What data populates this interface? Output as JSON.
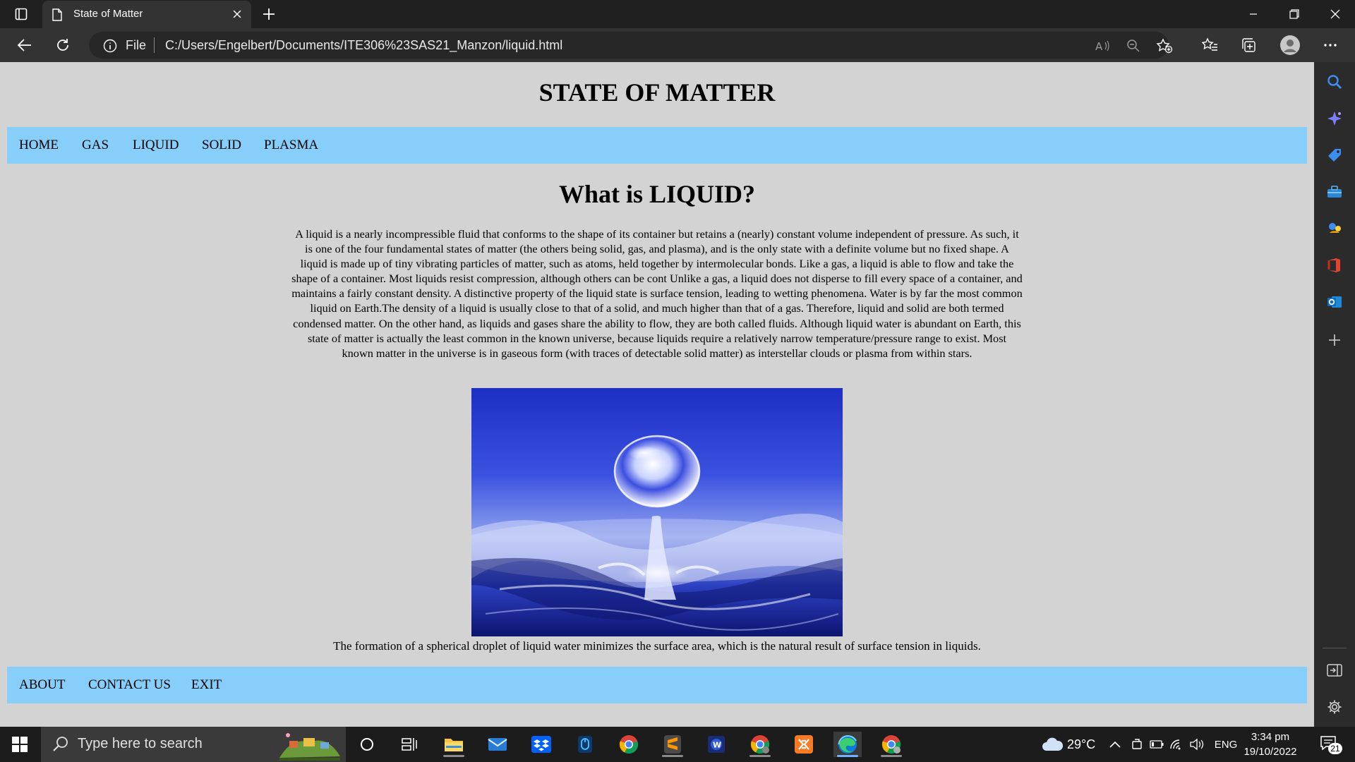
{
  "browser": {
    "tab_title": "State of Matter",
    "address_prefix": "File",
    "url": "C:/Users/Engelbert/Documents/ITE306%23SAS21_Manzon/liquid.html"
  },
  "page": {
    "site_title": "STATE OF MATTER",
    "nav": [
      "HOME",
      "GAS",
      "LIQUID",
      "SOLID",
      "PLASMA"
    ],
    "heading": "What is LIQUID?",
    "paragraph": "A liquid is a nearly incompressible fluid that conforms to the shape of its container but retains a (nearly) constant volume independent of pressure. As such, it is one of the four fundamental states of matter (the others being solid, gas, and plasma), and is the only state with a definite volume but no fixed shape. A liquid is made up of tiny vibrating particles of matter, such as atoms, held together by intermolecular bonds. Like a gas, a liquid is able to flow and take the shape of a container. Most liquids resist compression, although others can be cont Unlike a gas, a liquid does not disperse to fill every space of a container, and maintains a fairly constant density. A distinctive property of the liquid state is surface tension, leading to wetting phenomena. Water is by far the most common liquid on Earth.The density of a liquid is usually close to that of a solid, and much higher than that of a gas. Therefore, liquid and solid are both termed condensed matter. On the other hand, as liquids and gases share the ability to flow, they are both called fluids. Although liquid water is abundant on Earth, this state of matter is actually the least common in the known universe, because liquids require a relatively narrow temperature/pressure range to exist. Most known matter in the universe is in gaseous form (with traces of detectable solid matter) as interstellar clouds or plasma from within stars.",
    "caption": "The formation of a spherical droplet of liquid water minimizes the surface area, which is the natural result of surface tension in liquids.",
    "footer_nav": [
      "ABOUT",
      "CONTACT US",
      "EXIT"
    ],
    "bar_color": "#87cefa",
    "background_color": "#d3d3d3"
  },
  "taskbar": {
    "search_placeholder": "Type here to search",
    "weather": "29°C",
    "language": "ENG",
    "time": "3:34 pm",
    "date": "19/10/2022",
    "notification_count": "21"
  }
}
